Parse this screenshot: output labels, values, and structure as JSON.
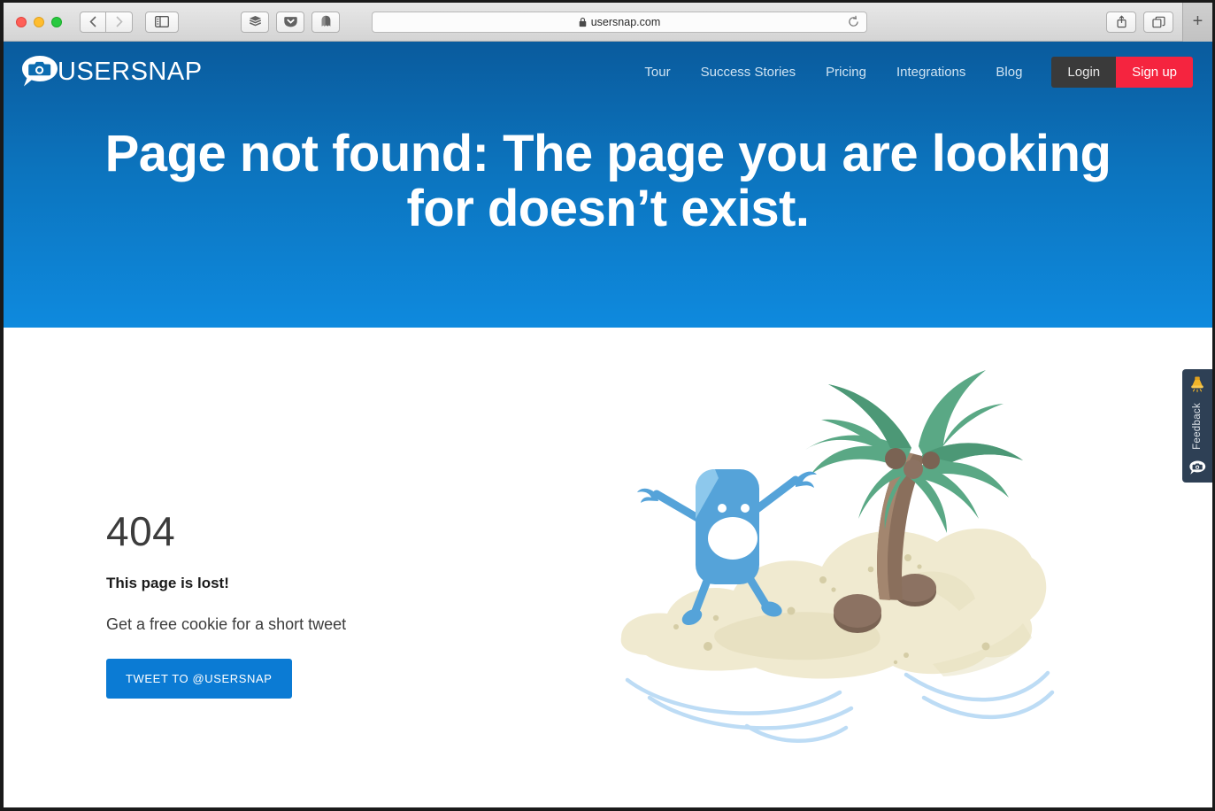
{
  "browser": {
    "url": "usersnap.com",
    "lock_icon": "lock-icon",
    "reload_icon": "reload-icon",
    "back_icon": "back-arrow-icon",
    "forward_icon": "forward-arrow-icon",
    "sidebar_icon": "sidebar-toggle-icon",
    "extensions": [
      "buffer-layers-icon",
      "pocket-icon",
      "ghostery-icon"
    ],
    "share_icon": "share-icon",
    "tabs_icon": "show-tabs-icon",
    "new_tab_label": "+"
  },
  "site": {
    "logo_text": "USERSNAP",
    "logo_icon": "usersnap-camera-bubble-icon"
  },
  "nav": {
    "links": [
      {
        "label": "Tour"
      },
      {
        "label": "Success Stories"
      },
      {
        "label": "Pricing"
      },
      {
        "label": "Integrations"
      },
      {
        "label": "Blog"
      }
    ],
    "login_label": "Login",
    "signup_label": "Sign up"
  },
  "hero": {
    "title": "Page not found: The page you are looking for doesn’t exist."
  },
  "main": {
    "error_code": "404",
    "headline": "This page is lost!",
    "subtext": "Get a free cookie for a short tweet",
    "cta_label": "TWEET TO @USERSNAP",
    "illustration_name": "desert-island-mascot-illustration"
  },
  "feedback_widget": {
    "label": "Feedback",
    "megaphone_icon": "megaphone-icon",
    "camera_icon": "usersnap-camera-bubble-icon"
  },
  "colors": {
    "hero_top": "#0a5b9d",
    "hero_bottom": "#0e8ade",
    "signup_red": "#f5243f",
    "login_dark": "#3a3a3a",
    "cta_blue": "#0b7bd4",
    "feedback_navy": "#2e4055",
    "megaphone_gold": "#f0b429"
  }
}
